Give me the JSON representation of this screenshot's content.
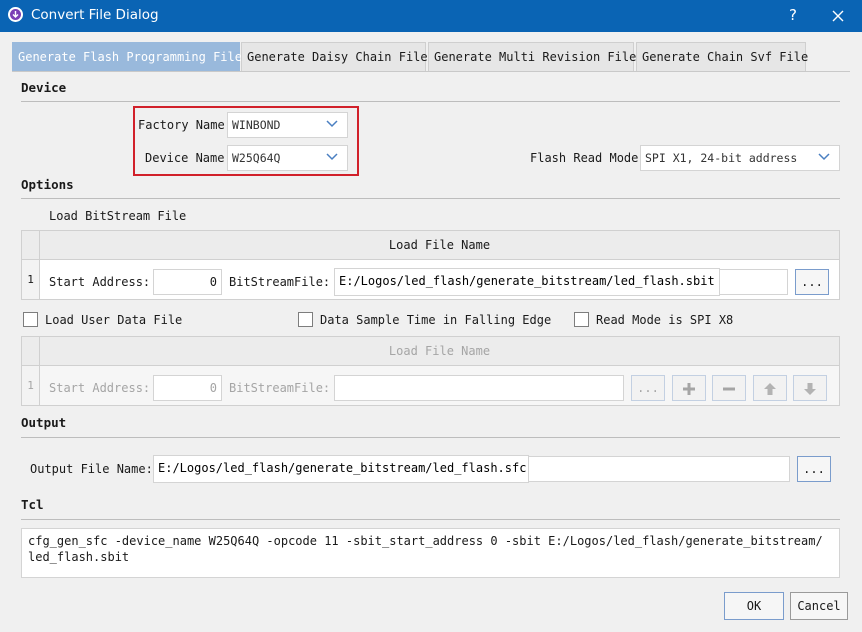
{
  "window": {
    "title": "Convert File Dialog",
    "help_glyph": "?",
    "close_glyph": "✕"
  },
  "tabs": [
    {
      "label": "Generate Flash Programming File",
      "active": true
    },
    {
      "label": "Generate Daisy Chain File",
      "active": false
    },
    {
      "label": "Generate Multi Revision File",
      "active": false
    },
    {
      "label": "Generate Chain Svf File",
      "active": false
    }
  ],
  "device": {
    "section_label": "Device",
    "factory_name_label": "Factory Name",
    "factory_name_value": "WINBOND",
    "device_name_label": "Device Name",
    "device_name_value": "W25Q64Q",
    "flash_read_mode_label": "Flash Read Mode",
    "flash_read_mode_value": "SPI X1, 24-bit address"
  },
  "options": {
    "section_label": "Options",
    "load_bitstream_label": "Load BitStream File",
    "grid1": {
      "header": "Load File Name",
      "row_num": "1",
      "start_address_label": "Start Address:",
      "start_address_value": "0",
      "bitstream_label": "BitStreamFile:",
      "bitstream_value": "E:/Logos/led_flash/generate_bitstream/led_flash.sbit",
      "browse_label": "..."
    },
    "load_user_data_label": "Load User Data File",
    "data_sample_label": "Data Sample Time in Falling Edge",
    "read_mode_x8_label": "Read Mode is SPI X8",
    "grid2": {
      "header": "Load File Name",
      "row_num": "1",
      "start_address_label": "Start Address:",
      "start_address_value": "0",
      "bitstream_label": "BitStreamFile:",
      "bitstream_value": "",
      "browse_label": "..."
    }
  },
  "output": {
    "section_label": "Output",
    "file_name_label": "Output File Name:",
    "file_name_value": "E:/Logos/led_flash/generate_bitstream/led_flash.sfc",
    "browse_label": "..."
  },
  "tcl": {
    "section_label": "Tcl",
    "command": "cfg_gen_sfc -device_name W25Q64Q -opcode 11 -sbit_start_address 0 -sbit E:/Logos/led_flash/generate_bitstream/\nled_flash.sbit"
  },
  "footer": {
    "ok_label": "OK",
    "cancel_label": "Cancel"
  },
  "colors": {
    "titlebar": "#0a64b4",
    "active_tab": "#99b9dc",
    "highlight_box": "#d1202a",
    "button_border": "#7a9ccc"
  }
}
